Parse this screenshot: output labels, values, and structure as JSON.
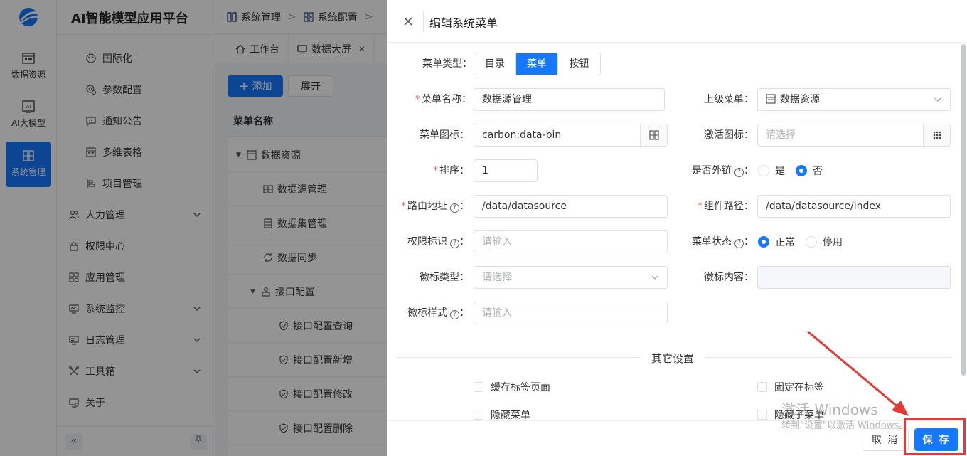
{
  "app": {
    "title": "AI智能模型应用平台",
    "rail": [
      {
        "label": "数据资源",
        "icon": "data-resource-icon"
      },
      {
        "label": "AI大模型",
        "icon": "ai-model-icon"
      },
      {
        "label": "系统管理",
        "icon": "system-icon",
        "active": true
      }
    ],
    "sidebar": {
      "sub_items": [
        "国际化",
        "参数配置",
        "通知公告",
        "多维表格",
        "项目管理"
      ],
      "groups": [
        {
          "label": "人力管理",
          "expandable": true
        },
        {
          "label": "权限中心",
          "expandable": false
        },
        {
          "label": "应用管理",
          "expandable": false
        },
        {
          "label": "系统监控",
          "expandable": true
        },
        {
          "label": "日志管理",
          "expandable": true
        },
        {
          "label": "工具箱",
          "expandable": true
        },
        {
          "label": "关于",
          "expandable": false
        }
      ],
      "collapse_glyph": "«"
    },
    "breadcrumb": [
      "系统管理",
      "系统配置"
    ],
    "tabs": [
      {
        "label": "工作台",
        "closable": false
      },
      {
        "label": "数据大屏",
        "closable": true
      }
    ],
    "toolbar": {
      "add_label": "添加",
      "expand_label": "展开"
    },
    "table": {
      "header": "菜单名称",
      "rows": [
        "数据资源",
        "数据源管理",
        "数据集管理",
        "数据同步",
        "接口配置",
        "接口配置查询",
        "接口配置新增",
        "接口配置修改",
        "接口配置删除"
      ]
    }
  },
  "drawer": {
    "title": "编辑系统菜单",
    "menu_type": {
      "label": "菜单类型：",
      "options": [
        "目录",
        "菜单",
        "按钮"
      ],
      "selected": "菜单"
    },
    "menu_name": {
      "label": "菜单名称：",
      "value": "数据源管理"
    },
    "parent_menu": {
      "label": "上级菜单：",
      "value": "数据资源"
    },
    "menu_icon": {
      "label": "菜单图标：",
      "value": "carbon:data-bin"
    },
    "active_icon": {
      "label": "激活图标：",
      "placeholder": "请选择"
    },
    "sort": {
      "label": "排序：",
      "value": "1"
    },
    "external_link": {
      "label": "是否外链",
      "options": [
        "是",
        "否"
      ],
      "selected": "否"
    },
    "route": {
      "label": "路由地址",
      "value": "/data/datasource"
    },
    "component": {
      "label": "组件路径：",
      "value": "/data/datasource/index"
    },
    "permission": {
      "label": "权限标识",
      "placeholder": "请输入"
    },
    "menu_status": {
      "label": "菜单状态",
      "options": [
        "正常",
        "停用"
      ],
      "selected": "正常"
    },
    "badge_type": {
      "label": "徽标类型：",
      "placeholder": "请选择"
    },
    "badge_content": {
      "label": "徽标内容："
    },
    "badge_style": {
      "label": "徽标样式",
      "placeholder": "请输入"
    },
    "other_settings": {
      "title": "其它设置",
      "checkboxes": [
        "缓存标签页面",
        "固定在标签",
        "隐藏菜单",
        "隐藏子菜单"
      ]
    },
    "footer": {
      "cancel_label": "取 消",
      "save_label": "保 存"
    }
  },
  "overlay": {
    "watermark_title": "激活 Windows",
    "watermark_sub": "转到\"设置\"以激活 Windows。"
  },
  "colors": {
    "primary": "#1677ff",
    "required": "#f56c6c",
    "annotation": "#e53935"
  }
}
